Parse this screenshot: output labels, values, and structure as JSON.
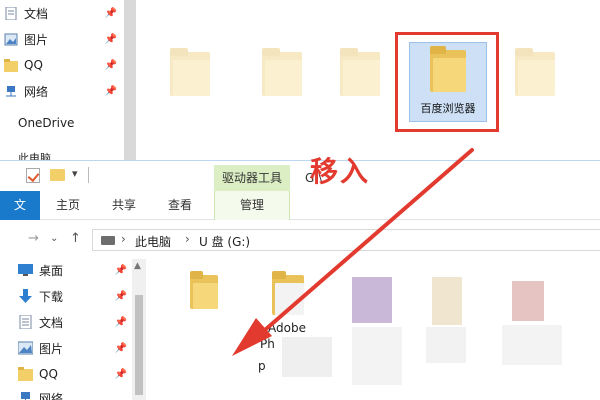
{
  "top_window": {
    "nav_items": [
      {
        "label": "文档",
        "icon": "documents-icon",
        "pinned": true
      },
      {
        "label": "图片",
        "icon": "pictures-icon",
        "pinned": true
      },
      {
        "label": "QQ",
        "icon": "folder-icon",
        "pinned": true
      },
      {
        "label": "网络",
        "icon": "network-icon",
        "pinned": true
      }
    ],
    "onedrive_label": "OneDrive",
    "this_pc_label": "此电脑",
    "selected_folder_label": "百度浏览器"
  },
  "bottom_window": {
    "contextual_tab": "驱动器工具",
    "title_text": "G:\\",
    "ribbon_tabs": [
      "主页",
      "共享",
      "查看"
    ],
    "manage_tab": "管理",
    "breadcrumb": [
      "此电脑",
      "U 盘 (G:)"
    ],
    "nav_items": [
      {
        "label": "桌面",
        "icon": "desktop-icon",
        "pinned": true
      },
      {
        "label": "下载",
        "icon": "download-icon",
        "pinned": true
      },
      {
        "label": "文档",
        "icon": "documents-icon",
        "pinned": true
      },
      {
        "label": "图片",
        "icon": "pictures-icon",
        "pinned": true
      },
      {
        "label": "QQ",
        "icon": "folder-icon",
        "pinned": true
      },
      {
        "label": "网络",
        "icon": "network-icon",
        "pinned": false
      }
    ],
    "content_labels": {
      "adobe_line1": "Adobe",
      "adobe_line2": "Ph",
      "adobe_line3": "p"
    }
  },
  "annotation": {
    "text": "移入",
    "color": "#e23a2f"
  },
  "colors": {
    "accent_file_tab": "#1979ca",
    "contextual_tab_bg": "#dcefc4",
    "folder_yellow": "#f6d77a",
    "selection_blue": "#cde0f6"
  }
}
